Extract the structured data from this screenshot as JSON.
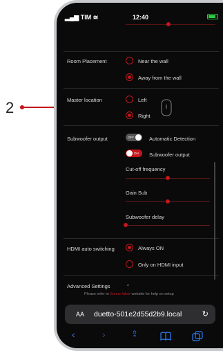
{
  "annotation": {
    "number": "2"
  },
  "status_bar": {
    "carrier": "TIM",
    "time": "12:40"
  },
  "settings": {
    "room_placement": {
      "label": "Room Placement",
      "options": [
        {
          "label": "Near the wall",
          "selected": false
        },
        {
          "label": "Away from the wall",
          "selected": true
        }
      ]
    },
    "master_location": {
      "label": "Master location",
      "options": [
        {
          "label": "Left",
          "selected": false
        },
        {
          "label": "Right",
          "selected": true
        }
      ]
    },
    "subwoofer_output": {
      "label": "Subwoofer output",
      "auto_detection": {
        "toggle_text": "OFF",
        "label": "Automatic Detection",
        "on": false
      },
      "output_toggle": {
        "toggle_text": "ON",
        "label": "Subwoofer output",
        "on": true
      },
      "cutoff_frequency": {
        "label": "Cut-off frequency",
        "value_fraction": 0.5
      },
      "gain_sub": {
        "label": "Gain Sub",
        "value_fraction": 0.5
      },
      "subwoofer_delay": {
        "label": "Subwoofer delay",
        "value_fraction": 0.0
      }
    },
    "hdmi_auto_switching": {
      "label": "HDMI auto switching",
      "options": [
        {
          "label": "Always ON",
          "selected": true
        },
        {
          "label": "Only on HDMI input",
          "selected": false
        }
      ]
    },
    "advanced_settings": {
      "label": "Advanced Settings"
    }
  },
  "footer": {
    "prefix": "Please refer to ",
    "link": "Sonus faber",
    "suffix": " website for help on setup"
  },
  "browser": {
    "aa_label": "AA",
    "url": "duetto-501e2d55d2b9.local"
  },
  "colors": {
    "accent": "#c4161c",
    "background": "#0a0a0a",
    "browser_blue": "#2f7ff5"
  }
}
